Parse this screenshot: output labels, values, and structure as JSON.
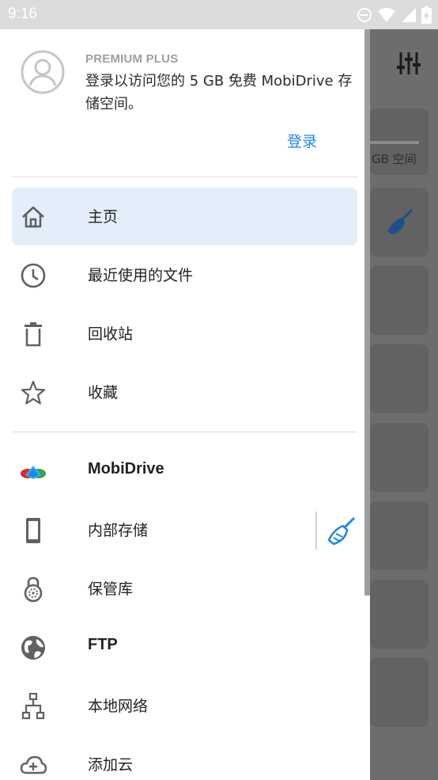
{
  "status_bar": {
    "time": "9:16",
    "icons": [
      "do-not-disturb-icon",
      "wifi-icon",
      "signal-icon",
      "battery-charging-icon"
    ]
  },
  "background": {
    "storage_text": "GB 空间",
    "icons": [
      "filter-sliders-icon",
      "broom-icon"
    ]
  },
  "drawer": {
    "account": {
      "plan": "PREMIUM PLUS",
      "message": "登录以访问您的 5 GB 免费 MobiDrive 存储空间。",
      "login_label": "登录"
    },
    "nav_primary": [
      {
        "label": "主页",
        "icon": "home-icon",
        "active": true
      },
      {
        "label": "最近使用的文件",
        "icon": "clock-icon",
        "active": false
      },
      {
        "label": "回收站",
        "icon": "trash-icon",
        "active": false
      },
      {
        "label": "收藏",
        "icon": "star-icon",
        "active": false
      }
    ],
    "nav_storage": [
      {
        "label": "MobiDrive",
        "icon": "mobidrive-logo-icon"
      },
      {
        "label": "内部存储",
        "icon": "phone-icon",
        "action_icon": "broom-icon"
      },
      {
        "label": "保管库",
        "icon": "vault-lock-icon"
      },
      {
        "label": "FTP",
        "icon": "globe-icon"
      },
      {
        "label": "本地网络",
        "icon": "network-icon"
      },
      {
        "label": "添加云",
        "icon": "cloud-add-icon"
      }
    ]
  },
  "colors": {
    "accent": "#1e88e5",
    "active_bg": "#e3eefa",
    "icon_gray": "#616161"
  }
}
